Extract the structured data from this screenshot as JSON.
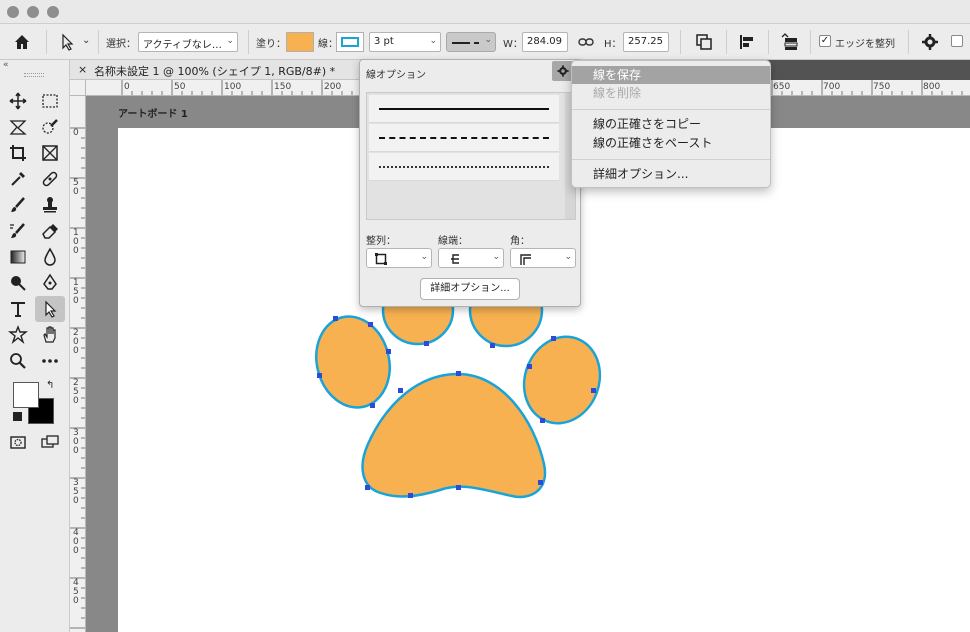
{
  "options_bar": {
    "select_label": "選択：",
    "select_value": "アクティブなレ…",
    "fill_label": "塗り：",
    "fill_color": "#f7b150",
    "stroke_label": "線：",
    "stroke_color": "#19a3d9",
    "stroke_width": "3 pt",
    "w_label": "W：",
    "w_value": "284.09",
    "h_label": "H：",
    "h_value": "257.25",
    "align_edges_label": "エッジを整列"
  },
  "document": {
    "tab_title": "名称未設定 1 @ 100% (シェイプ 1, RGB/8#) *",
    "artboard_label": "アートボード 1",
    "ruler_h": [
      "0",
      "50",
      "100",
      "150",
      "200",
      "650",
      "700",
      "750",
      "800"
    ],
    "ruler_v": [
      "0",
      "5 0",
      "1 0 0",
      "1 5 0",
      "2 0 0",
      "2 5 0",
      "3 0 0",
      "3 5 0",
      "4 0 0",
      "4 5 0"
    ]
  },
  "stroke_panel": {
    "title": "線オプション",
    "align_label": "整列：",
    "cap_label": "線端：",
    "corner_label": "角：",
    "detail_button": "詳細オプション..."
  },
  "flyout_menu": {
    "items": [
      {
        "label": "線を保存",
        "state": "highlighted"
      },
      {
        "label": "線を削除",
        "state": "disabled"
      },
      {
        "label": "線の正確さをコピー",
        "state": "normal"
      },
      {
        "label": "線の正確さをペースト",
        "state": "normal"
      },
      {
        "label": "詳細オプション...",
        "state": "normal"
      }
    ]
  },
  "colors": {
    "paw_fill": "#f7b150",
    "paw_stroke": "#19a3d9",
    "anchor": "#2b4bd9",
    "foreground": "#ffffff",
    "background": "#000000"
  }
}
